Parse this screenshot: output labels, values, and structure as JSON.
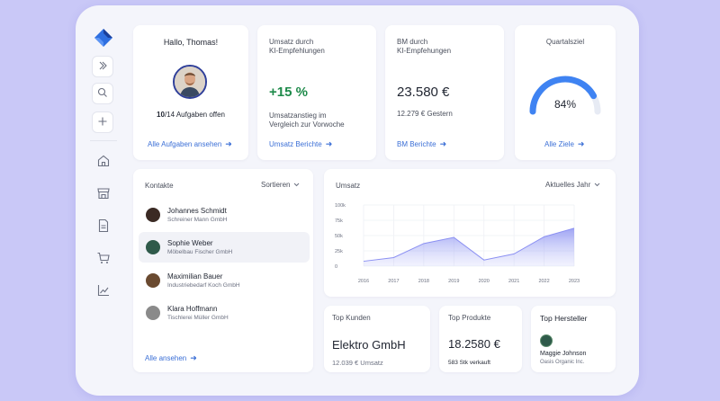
{
  "sidebar": {
    "icons": [
      "logo-icon",
      "expand-icon",
      "search-icon",
      "plus-icon",
      "home-icon",
      "store-icon",
      "document-icon",
      "cart-icon",
      "chart-icon"
    ]
  },
  "welcome": {
    "greeting": "Hallo, Thomas!",
    "tasks_done": "10",
    "tasks_rest": "/14 Aufgaben offen",
    "link": "Alle Aufgaben ansehen"
  },
  "umsatz_ki": {
    "title_line1": "Umsatz durch",
    "title_line2": "KI-Empfehlungen",
    "value": "+15 %",
    "desc_line1": "Umsatzanstieg im",
    "desc_line2": "Vergleich zur Vorwoche",
    "link": "Umsatz Berichte"
  },
  "bm_ki": {
    "title_line1": "BM durch",
    "title_line2": "KI-Empfehungen",
    "value": "23.580 €",
    "sub": "12.279 € Gestern",
    "link": "BM Berichte"
  },
  "quartalsziel": {
    "title": "Quartalsziel",
    "value": "84%",
    "progress": 0.84,
    "link": "Alle Ziele"
  },
  "contacts": {
    "title": "Kontakte",
    "sort": "Sortieren",
    "items": [
      {
        "name": "Johannes Schmidt",
        "company": "Schreiner Mann GmbH"
      },
      {
        "name": "Sophie Weber",
        "company": "Möbelbau Fischer GmbH"
      },
      {
        "name": "Maximilian Bauer",
        "company": "Industriebedarf Koch GmbH"
      },
      {
        "name": "Klara Hoffmann",
        "company": "Tischlerei Müller GmbH"
      }
    ],
    "link": "Alle ansehen"
  },
  "umsatz_chart": {
    "title": "Umsatz",
    "period": "Aktuelles Jahr"
  },
  "chart_data": {
    "type": "area",
    "title": "Umsatz",
    "x": [
      "2016",
      "2017",
      "2018",
      "2019",
      "2020",
      "2021",
      "2022",
      "2023"
    ],
    "series": [
      {
        "values": [
          8000,
          14000,
          37000,
          47000,
          10000,
          20000,
          48000,
          62000
        ]
      }
    ],
    "yticks": [
      "100k",
      "75k",
      "50k",
      "25k",
      "0"
    ],
    "ylim": [
      0,
      100000
    ],
    "grid": true
  },
  "top_kunden": {
    "title": "Top Kunden",
    "value": "Elektro GmbH",
    "sub": "12.039 € Umsatz"
  },
  "top_produkte": {
    "title": "Top Produkte",
    "value": "18.2580 €",
    "sub": "583 Stk verkauft"
  },
  "top_hersteller": {
    "title": "Top Hersteller",
    "name": "Maggie Johnson",
    "company": "Oasis Organic Inc."
  },
  "colors": {
    "accent": "#3b6fd6",
    "gauge": "#3f83f2",
    "background": "#c9c8f7"
  }
}
